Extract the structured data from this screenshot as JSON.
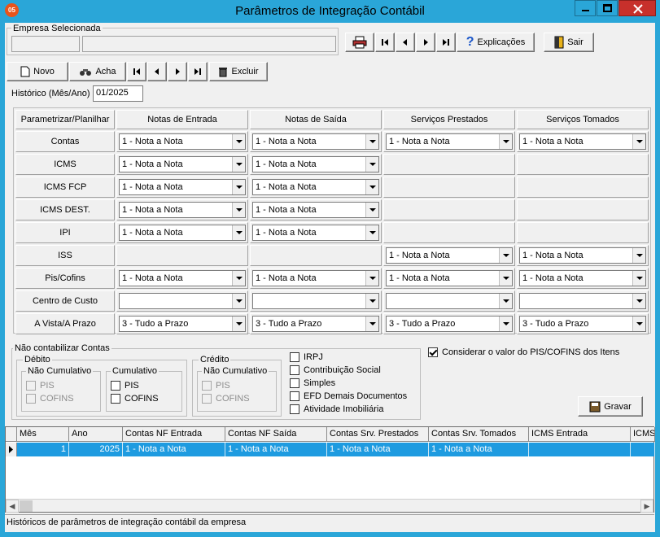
{
  "window": {
    "title": "Parâmetros de Integração Contábil",
    "icon_text": "05"
  },
  "empresa": {
    "legend": "Empresa Selecionada",
    "code": "",
    "name": ""
  },
  "top_toolbar": {
    "explicacoes": "Explicações",
    "sair": "Sair"
  },
  "toolbar": {
    "novo": "Novo",
    "acha": "Acha",
    "excluir": "Excluir"
  },
  "historico": {
    "label": "Histórico (Mês/Ano)",
    "value": "01/2025"
  },
  "params": {
    "headers": [
      "Parametrizar/Planilhar",
      "Notas de Entrada",
      "Notas de Saída",
      "Serviços Prestados",
      "Serviços Tomados"
    ],
    "rows": [
      {
        "label": "Contas",
        "cells": [
          "1 - Nota a Nota",
          "1 - Nota a Nota",
          "1 - Nota a Nota",
          "1 - Nota a Nota"
        ]
      },
      {
        "label": "ICMS",
        "cells": [
          "1 - Nota a Nota",
          "1 - Nota a Nota",
          null,
          null
        ]
      },
      {
        "label": "ICMS FCP",
        "cells": [
          "1 - Nota a Nota",
          "1 - Nota a Nota",
          null,
          null
        ]
      },
      {
        "label": "ICMS DEST.",
        "cells": [
          "1 - Nota a Nota",
          "1 - Nota a Nota",
          null,
          null
        ]
      },
      {
        "label": "IPI",
        "cells": [
          "1 - Nota a Nota",
          "1 - Nota a Nota",
          null,
          null
        ]
      },
      {
        "label": "ISS",
        "cells": [
          null,
          null,
          "1 - Nota a Nota",
          "1 - Nota a Nota"
        ]
      },
      {
        "label": "Pis/Cofins",
        "cells": [
          "1 - Nota a Nota",
          "1 - Nota a Nota",
          "1 - Nota a Nota",
          "1 - Nota a Nota"
        ]
      },
      {
        "label": "Centro de Custo",
        "cells": [
          "",
          "",
          "",
          ""
        ]
      },
      {
        "label": "A Vista/A Prazo",
        "cells": [
          "3 - Tudo a Prazo",
          "3 - Tudo a Prazo",
          "3 - Tudo a Prazo",
          "3 - Tudo a Prazo"
        ]
      }
    ]
  },
  "nao_contabilizar": {
    "legend": "Não contabilizar Contas",
    "debito": {
      "legend": "Débito",
      "nao_cumulativo": {
        "legend": "Não Cumulativo",
        "pis": "PIS",
        "cofins": "COFINS"
      },
      "cumulativo": {
        "legend": "Cumulativo",
        "pis": "PIS",
        "cofins": "COFINS"
      }
    },
    "credito": {
      "legend": "Crédito",
      "nao_cumulativo": {
        "legend": "Não Cumulativo",
        "pis": "PIS",
        "cofins": "COFINS"
      }
    },
    "outros": [
      "IRPJ",
      "Contribuição Social",
      "Simples",
      "EFD Demais Documentos",
      "Atividade Imobiliária"
    ]
  },
  "considerar": {
    "label": "Considerar o valor do PIS/COFINS dos Itens",
    "checked": true
  },
  "gravar": {
    "label": "Gravar"
  },
  "history_grid": {
    "columns": [
      "Mês",
      "Ano",
      "Contas NF Entrada",
      "Contas NF Saída",
      "Contas Srv. Prestados",
      "Contas Srv. Tomados",
      "ICMS Entrada",
      "ICMS"
    ],
    "rows": [
      [
        "1",
        "2025",
        "1 - Nota a Nota",
        "1 - Nota a Nota",
        "1 - Nota a Nota",
        "1 - Nota a Nota",
        "",
        ""
      ]
    ]
  },
  "status": {
    "text": "Históricos de parâmetros de integração contábil da empresa"
  },
  "colors": {
    "titlebar": "#2aa6d8",
    "selection": "#1e9be0",
    "close": "#c7302b"
  }
}
